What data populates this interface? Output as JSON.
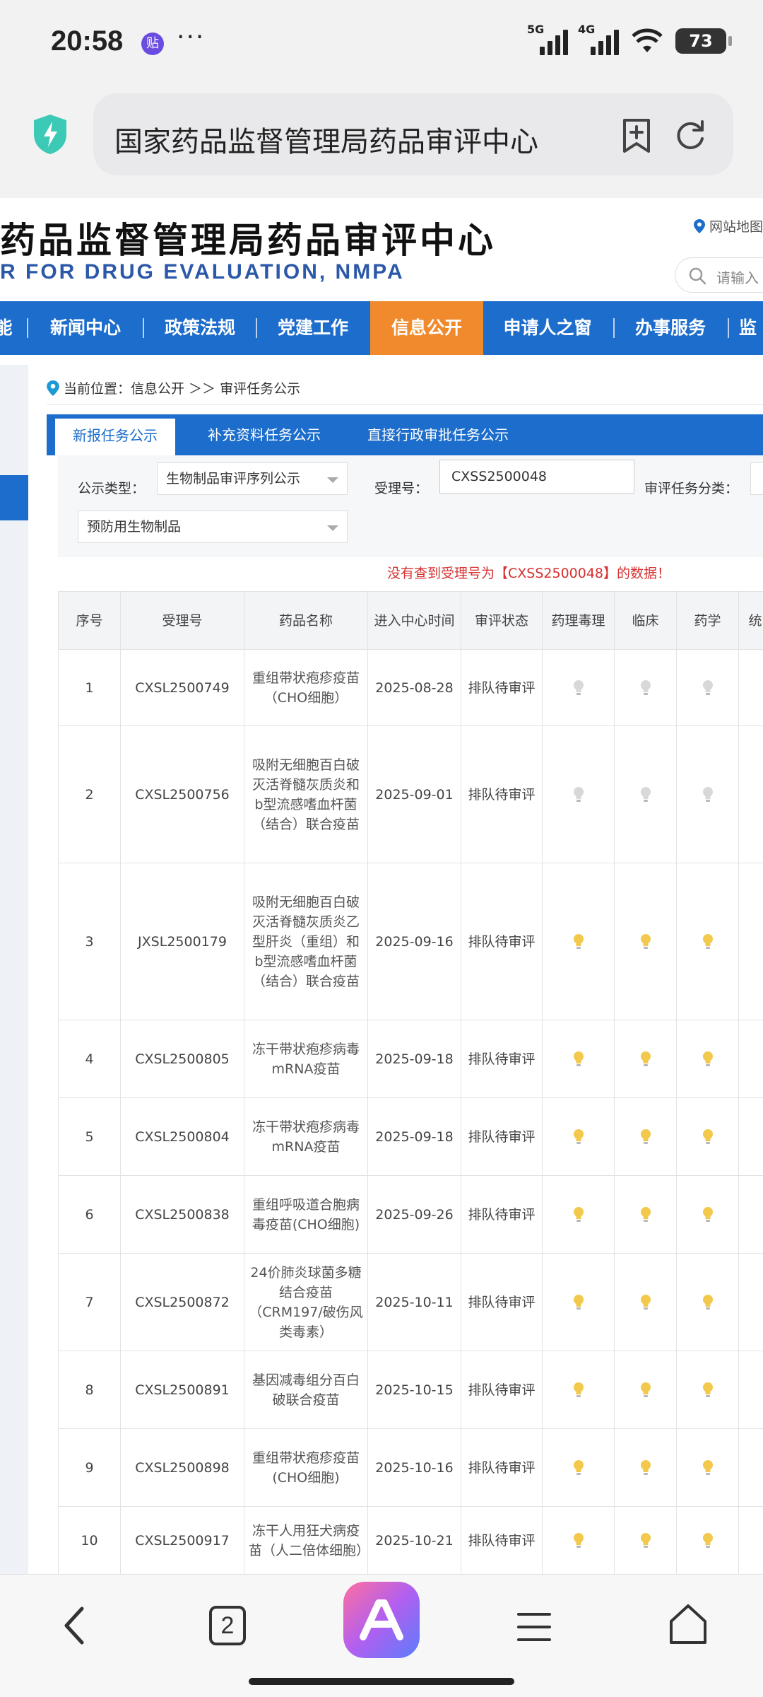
{
  "status_bar": {
    "time": "20:58",
    "app_badge": "贴",
    "more": "···",
    "net1": "5G",
    "net2": "4G",
    "battery": "73"
  },
  "address_bar": {
    "title": "国家药品监督管理局药品审评中心"
  },
  "site": {
    "title_cn": "药品监督管理局药品审评中心",
    "title_en": "R FOR DRUG EVALUATION, NMPA",
    "sitemap": "网站地图",
    "search_placeholder": "请输入"
  },
  "nav": [
    "能",
    "新闻中心",
    "政策法规",
    "党建工作",
    "信息公开",
    "申请人之窗",
    "办事服务",
    "监"
  ],
  "breadcrumb": {
    "label": "当前位置：信息公开 ＞＞ 审评任务公示"
  },
  "tabs": [
    "新报任务公示",
    "补充资料任务公示",
    "直接行政审批任务公示"
  ],
  "filters": {
    "type_label": "公示类型：",
    "type_value": "生物制品审评序列公示",
    "accept_label": "受理号：",
    "accept_value": "CXSS2500048",
    "task_label": "审评任务分类：",
    "sub_value": "预防用生物制品"
  },
  "notice": "没有查到受理号为【CXSS2500048】的数据！",
  "table": {
    "headers": [
      "序号",
      "受理号",
      "药品名称",
      "进入中心时间",
      "审评状态",
      "药理毒理",
      "临床",
      "药学",
      "统"
    ],
    "rows": [
      {
        "no": "1",
        "id": "CXSL2500749",
        "name": "重组带状疱疹疫苗（CHO细胞）",
        "date": "2025-08-28",
        "status": "排队待审评",
        "lit": false
      },
      {
        "no": "2",
        "id": "CXSL2500756",
        "name": "吸附无细胞百白破灭活脊髓灰质炎和b型流感嗜血杆菌（结合）联合疫苗",
        "date": "2025-09-01",
        "status": "排队待审评",
        "lit": false
      },
      {
        "no": "3",
        "id": "JXSL2500179",
        "name": "吸附无细胞百白破灭活脊髓灰质炎乙型肝炎（重组）和b型流感嗜血杆菌（结合）联合疫苗",
        "date": "2025-09-16",
        "status": "排队待审评",
        "lit": true
      },
      {
        "no": "4",
        "id": "CXSL2500805",
        "name": "冻干带状疱疹病毒mRNA疫苗",
        "date": "2025-09-18",
        "status": "排队待审评",
        "lit": true
      },
      {
        "no": "5",
        "id": "CXSL2500804",
        "name": "冻干带状疱疹病毒mRNA疫苗",
        "date": "2025-09-18",
        "status": "排队待审评",
        "lit": true
      },
      {
        "no": "6",
        "id": "CXSL2500838",
        "name": "重组呼吸道合胞病毒疫苗(CHO细胞)",
        "date": "2025-09-26",
        "status": "排队待审评",
        "lit": true
      },
      {
        "no": "7",
        "id": "CXSL2500872",
        "name": "24价肺炎球菌多糖结合疫苗（CRM197/破伤风类毒素）",
        "date": "2025-10-11",
        "status": "排队待审评",
        "lit": true
      },
      {
        "no": "8",
        "id": "CXSL2500891",
        "name": "基因减毒组分百白破联合疫苗",
        "date": "2025-10-15",
        "status": "排队待审评",
        "lit": true
      },
      {
        "no": "9",
        "id": "CXSL2500898",
        "name": "重组带状疱疹疫苗(CHO细胞)",
        "date": "2025-10-16",
        "status": "排队待审评",
        "lit": true
      },
      {
        "no": "10",
        "id": "CXSL2500917",
        "name": "冻干人用狂犬病疫苗（人二倍体细胞）",
        "date": "2025-10-21",
        "status": "排队待审评",
        "lit": true
      }
    ]
  },
  "bottom": {
    "tab_count": "2"
  },
  "colors": {
    "brand_blue": "#1c6dcc",
    "active_orange": "#f08a2c",
    "notice_red": "#d62f2f",
    "bulb_on": "#f2c94c",
    "bulb_off": "#d8d8d8"
  }
}
